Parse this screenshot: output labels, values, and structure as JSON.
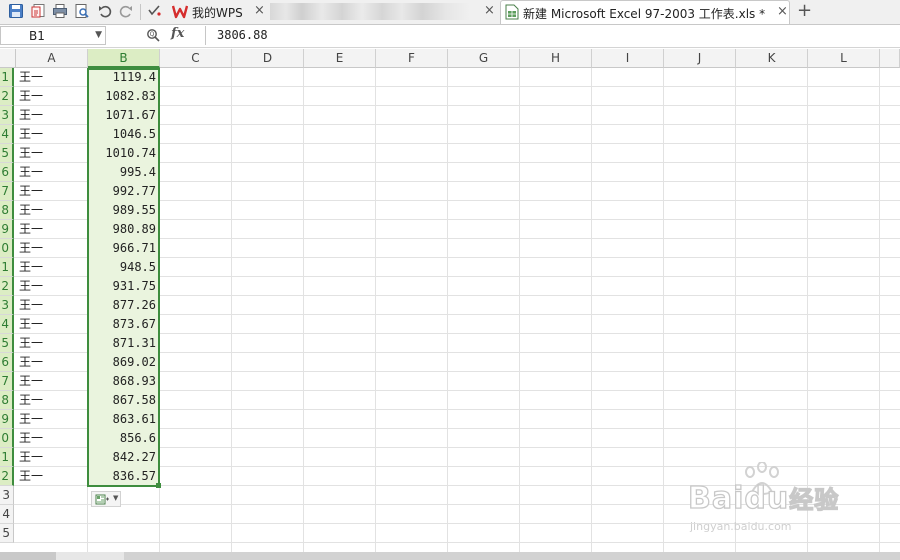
{
  "tabs": [
    {
      "title": "我的WPS",
      "close": "×"
    },
    {
      "title": "",
      "close": "×"
    },
    {
      "title": "新建 Microsoft Excel 97-2003 工作表.xls *",
      "close": "×"
    }
  ],
  "new_tab_symbol": "+",
  "formula_bar": {
    "name_box": "B1",
    "fx_label": "fx",
    "value": "3806.88"
  },
  "columns": [
    "A",
    "B",
    "C",
    "D",
    "E",
    "F",
    "G",
    "H",
    "I",
    "J",
    "K",
    "L"
  ],
  "row_labels": [
    "1",
    "2",
    "3",
    "4",
    "5",
    "6",
    "7",
    "8",
    "9",
    "0",
    "1",
    "2",
    "3",
    "4",
    "5",
    "6",
    "7",
    "8",
    "9",
    "0",
    "1",
    "2",
    "3",
    "4",
    "5"
  ],
  "rows": [
    {
      "a": "王一",
      "b": "1119.4"
    },
    {
      "a": "王一",
      "b": "1082.83"
    },
    {
      "a": "王一",
      "b": "1071.67"
    },
    {
      "a": "王一",
      "b": "1046.5"
    },
    {
      "a": "王一",
      "b": "1010.74"
    },
    {
      "a": "王一",
      "b": "995.4"
    },
    {
      "a": "王一",
      "b": "992.77"
    },
    {
      "a": "王一",
      "b": "989.55"
    },
    {
      "a": "王一",
      "b": "980.89"
    },
    {
      "a": "王一",
      "b": "966.71"
    },
    {
      "a": "王一",
      "b": "948.5"
    },
    {
      "a": "王一",
      "b": "931.75"
    },
    {
      "a": "王一",
      "b": "877.26"
    },
    {
      "a": "王一",
      "b": "873.67"
    },
    {
      "a": "王一",
      "b": "871.31"
    },
    {
      "a": "王一",
      "b": "869.02"
    },
    {
      "a": "王一",
      "b": "868.93"
    },
    {
      "a": "王一",
      "b": "867.58"
    },
    {
      "a": "王一",
      "b": "863.61"
    },
    {
      "a": "王一",
      "b": "856.6"
    },
    {
      "a": "王一",
      "b": "842.27"
    },
    {
      "a": "王一",
      "b": "836.57"
    }
  ],
  "selected_column": "B",
  "watermark_text": {
    "brand": "Baidu",
    "suffix": "经验",
    "url": "jingyan.baidu.com"
  },
  "icons": [
    "save-icon",
    "export-icon",
    "print-icon",
    "print-preview-icon",
    "undo-icon",
    "redo-icon",
    "dropdown-icon",
    "wps-logo-icon",
    "sheet-icon",
    "search-icon",
    "paste-options-icon"
  ],
  "colors": {
    "selection": "#3e8d3e",
    "selection_fill": "#eaf4de",
    "header_selected": "#dcedc4",
    "wps_red": "#d52d2d"
  }
}
